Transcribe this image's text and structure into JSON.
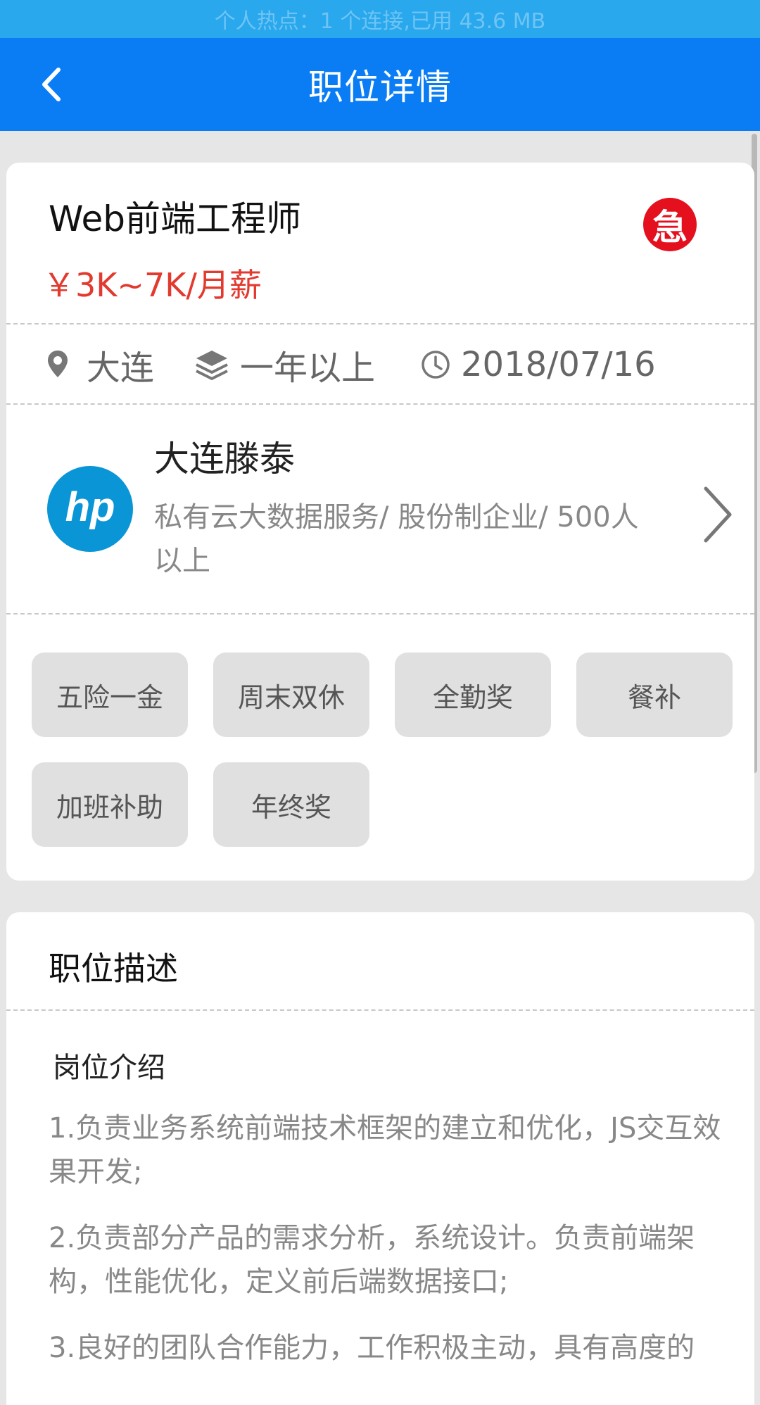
{
  "status_bar": {
    "text": "个人热点：1 个连接,已用 43.6 MB"
  },
  "header": {
    "title": "职位详情",
    "back_icon": "chevron-left-icon"
  },
  "job": {
    "title": "Web前端工程师",
    "urgent_badge": "急",
    "salary": "￥3K~7K/月薪",
    "location": "大连",
    "experience": "一年以上",
    "date": "2018/07/16"
  },
  "company": {
    "name": "大连滕泰",
    "description": "私有云大数据服务/ 股份制企业/ 500人以上",
    "logo_text": "hp"
  },
  "benefits": [
    "五险一金",
    "周末双休",
    "全勤奖",
    "餐补",
    "加班补助",
    "年终奖"
  ],
  "description": {
    "section_title": "职位描述",
    "subtitle": "岗位介绍",
    "paragraphs": [
      "1.负责业务系统前端技术框架的建立和优化，JS交互效果开发;",
      "2.负责部分产品的需求分析，系统设计。负责前端架构，性能优化，定义前后端数据接口;",
      "3.良好的团队合作能力，工作积极主动，具有高度的"
    ]
  },
  "colors": {
    "status_bar": "#29a8ee",
    "nav_bar": "#0a7df5",
    "salary": "#e23a2f",
    "urgent": "#e5101e",
    "logo": "#0a96d6"
  }
}
